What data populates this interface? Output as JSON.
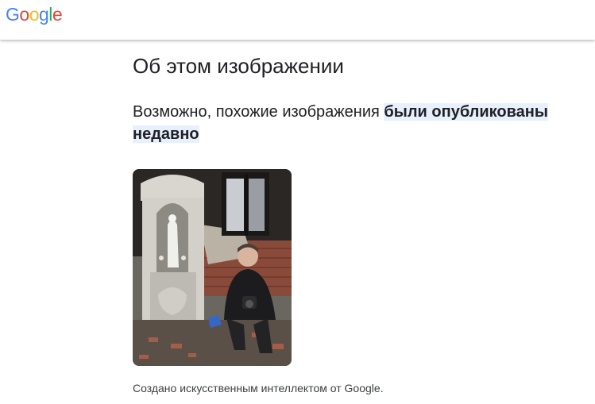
{
  "header": {
    "logo_letters": [
      {
        "ch": "G",
        "color": "#4285F4"
      },
      {
        "ch": "o",
        "color": "#EA4335"
      },
      {
        "ch": "o",
        "color": "#FBBC05"
      },
      {
        "ch": "g",
        "color": "#4285F4"
      },
      {
        "ch": "l",
        "color": "#34A853"
      },
      {
        "ch": "e",
        "color": "#EA4335"
      }
    ]
  },
  "main": {
    "title": "Об этом изображении",
    "subheading_plain": "Возможно, похожие изображения ",
    "subheading_highlight": "были опубликованы недавно",
    "caption": "Создано искусственным интеллектом от Google."
  },
  "colors": {
    "highlight_bg": "#e8f0fe",
    "text_primary": "#202124",
    "text_secondary": "#3c4043"
  }
}
